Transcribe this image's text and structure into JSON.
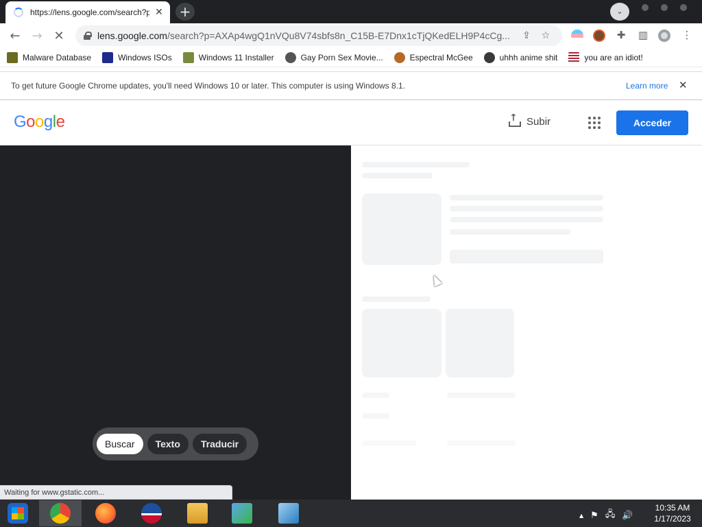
{
  "browser": {
    "tab_title": "https://lens.google.com/search?p",
    "tab_close": "✕",
    "new_tab": "+",
    "tab_search": "⌄",
    "back": "←",
    "forward": "→",
    "reload": "✕",
    "url_host": "lens.google.com",
    "url_path": "/search?p=AXAp4wgQ1nVQu8V74sbfs8n_C15B-E7Dnx1cTjQKedELH9P4cCg...",
    "share_icon": "⇪",
    "bookmark_star": "☆",
    "puzzle_icon": "✚",
    "side_panel_icon": "▥",
    "menu_icon": "⋮"
  },
  "bookmarks": [
    {
      "label": "Malware Database",
      "color": "#6b6b20"
    },
    {
      "label": "Windows ISOs",
      "color": "#1f2a8a"
    },
    {
      "label": "Windows 11 Installer",
      "color": "#7a8a3c"
    },
    {
      "label": "Gay Porn Sex Movie...",
      "color": "#555555"
    },
    {
      "label": "Espectral McGee",
      "color": "#b56a2a"
    },
    {
      "label": "uhhh anime shit",
      "color": "#3a3a3a"
    },
    {
      "label": "you are an idiot!",
      "color": "#b22234"
    }
  ],
  "infobar": {
    "message": "To get future Google Chrome updates, you'll need Windows 10 or later. This computer is using Windows 8.1.",
    "learn_more": "Learn more",
    "close": "✕"
  },
  "lens": {
    "logo": [
      "G",
      "o",
      "o",
      "g",
      "l",
      "e"
    ],
    "logo_colors": [
      "#4285f4",
      "#ea4335",
      "#fbbc05",
      "#4285f4",
      "#34a853",
      "#ea4335"
    ],
    "upload_label": "Subir",
    "signin_label": "Acceder",
    "modes": [
      "Buscar",
      "Texto",
      "Traducir"
    ],
    "active_mode": "Buscar"
  },
  "status_text": "Waiting for www.gstatic.com...",
  "taskbar": {
    "time": "10:35 AM",
    "date": "1/17/2023",
    "tray_up": "▲",
    "flag_icon": "⚑",
    "network_icon": "🖧",
    "volume_icon": "🔊"
  }
}
